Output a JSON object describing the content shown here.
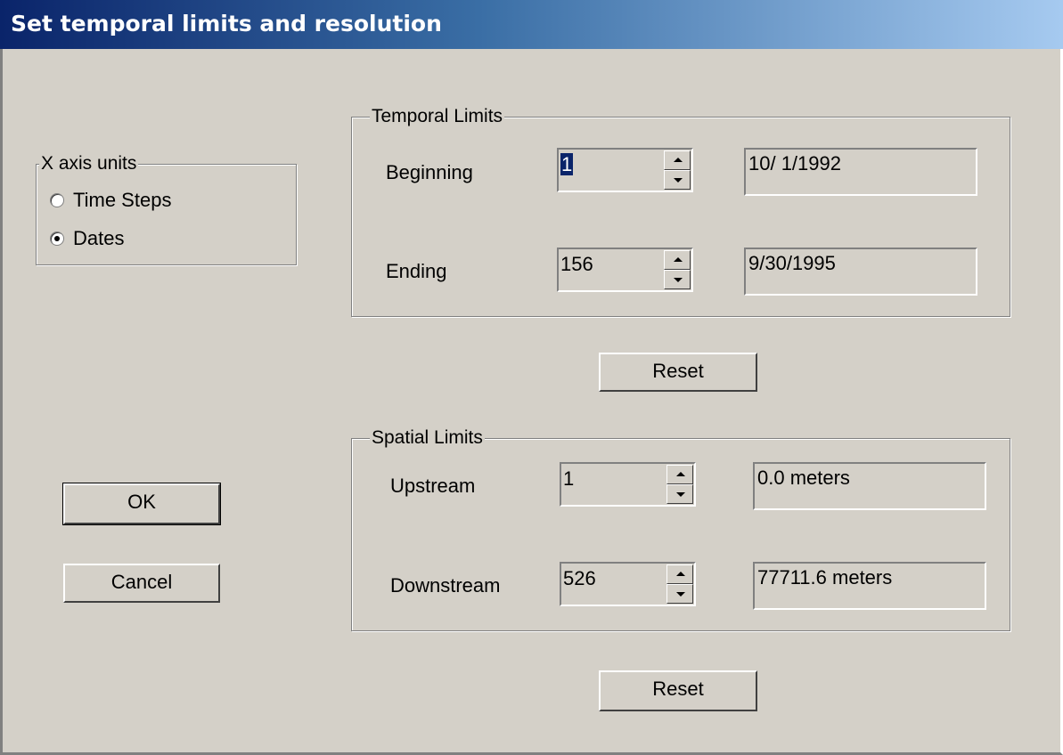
{
  "window": {
    "title": "Set temporal limits and resolution"
  },
  "x_axis_units": {
    "title": "X axis units",
    "options": [
      {
        "label": "Time Steps",
        "selected": false
      },
      {
        "label": "Dates",
        "selected": true
      }
    ]
  },
  "temporal_limits": {
    "title": "Temporal Limits",
    "beginning": {
      "label": "Beginning",
      "value": "1",
      "display": "10/ 1/1992"
    },
    "ending": {
      "label": "Ending",
      "value": "156",
      "display": "9/30/1995"
    },
    "reset_label": "Reset"
  },
  "spatial_limits": {
    "title": "Spatial Limits",
    "upstream": {
      "label": "Upstream",
      "value": "1",
      "display": "0.0 meters"
    },
    "downstream": {
      "label": "Downstream",
      "value": "526",
      "display": "77711.6 meters"
    },
    "reset_label": "Reset"
  },
  "buttons": {
    "ok_label": "OK",
    "cancel_label": "Cancel"
  },
  "colors": {
    "titlebar_start": "#0a246a",
    "titlebar_end": "#a6caf0",
    "face": "#d4d0c8"
  }
}
